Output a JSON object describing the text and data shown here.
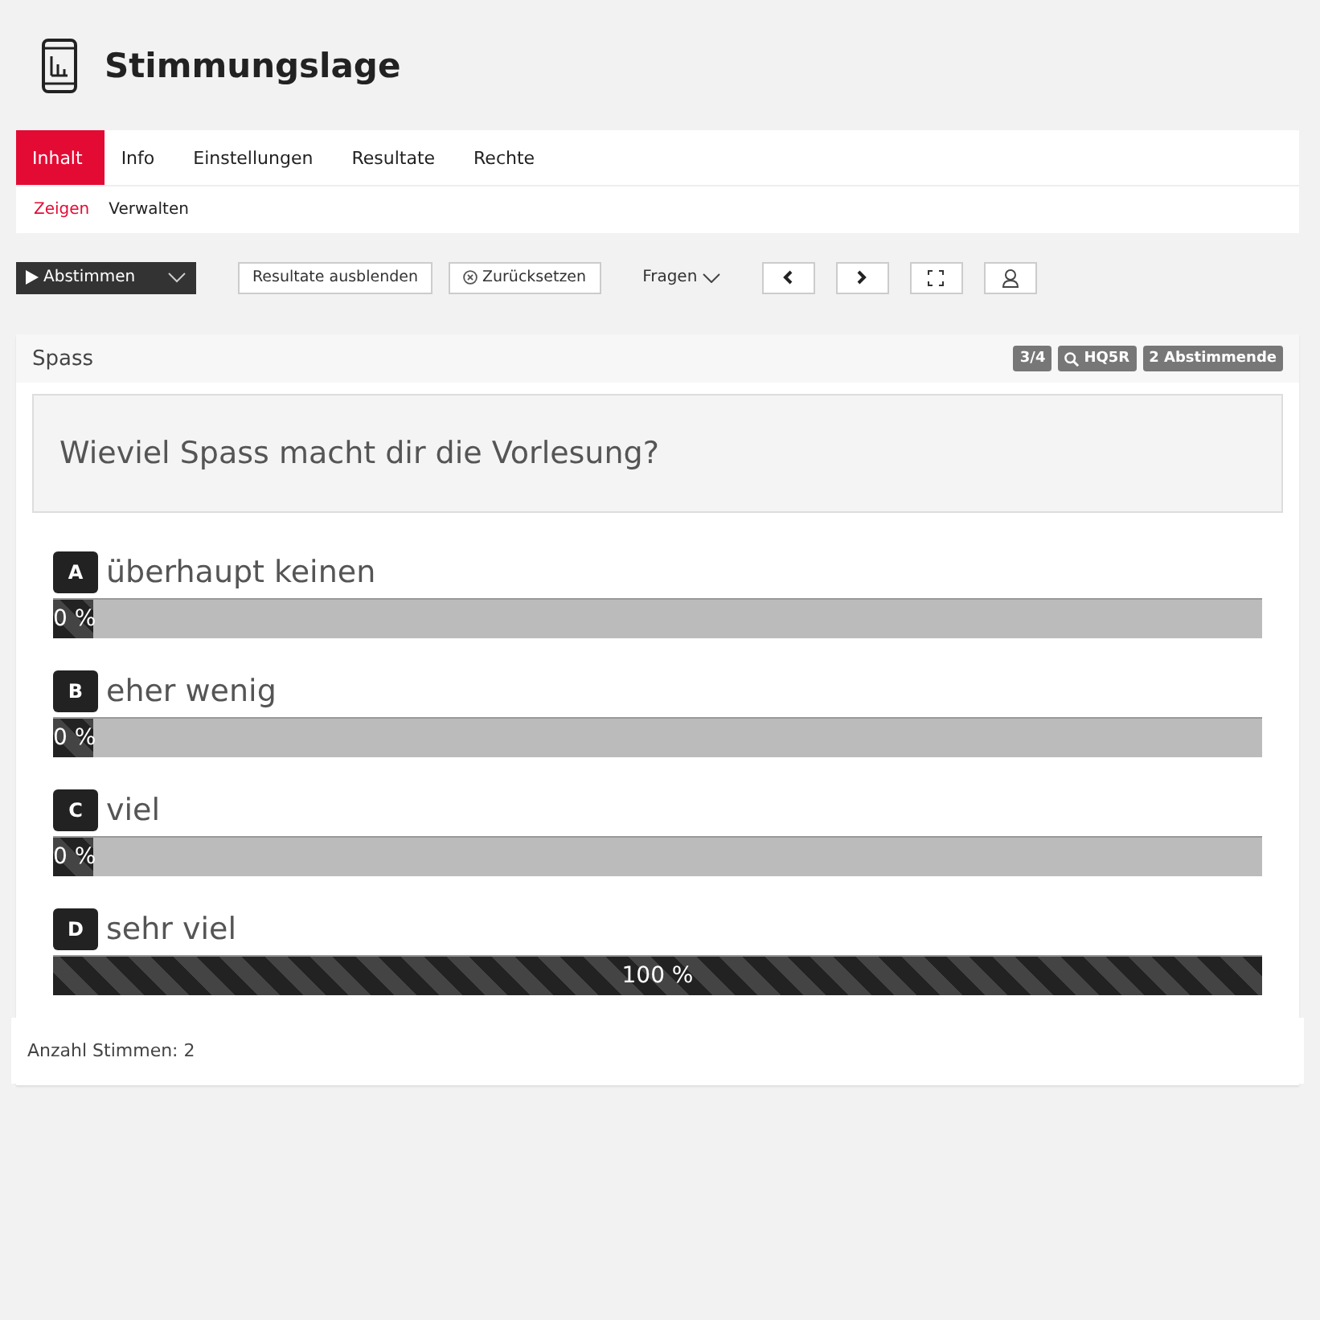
{
  "header": {
    "title": "Stimmungslage"
  },
  "tabs": [
    {
      "label": "Inhalt",
      "selected": true
    },
    {
      "label": "Info",
      "selected": false
    },
    {
      "label": "Einstellungen",
      "selected": false
    },
    {
      "label": "Resultate",
      "selected": false
    },
    {
      "label": "Rechte",
      "selected": false
    }
  ],
  "subtabs": [
    {
      "label": "Zeigen",
      "selected": true
    },
    {
      "label": "Verwalten",
      "selected": false
    }
  ],
  "toolbar": {
    "vote_button": "Abstimmen",
    "hide_results": "Resultate ausblenden",
    "reset": "Zurücksetzen",
    "questions_menu": "Fragen"
  },
  "card": {
    "title": "Spass",
    "badges": [
      "3/4",
      "HQ5R",
      "2 Abstimmende"
    ],
    "question": "Wieviel Spass macht dir die Vorlesung?",
    "answers": [
      {
        "letter": "A",
        "text": "überhaupt keinen",
        "level": 0,
        "reading": "0 %"
      },
      {
        "letter": "B",
        "text": "eher wenig",
        "level": 0,
        "reading": "0 %"
      },
      {
        "letter": "C",
        "text": "viel",
        "level": 0,
        "reading": "0 %"
      },
      {
        "letter": "D",
        "text": "sehr viel",
        "level": 1,
        "reading": "100 %"
      }
    ],
    "footer": "Anzahl Stimmen: 2"
  }
}
